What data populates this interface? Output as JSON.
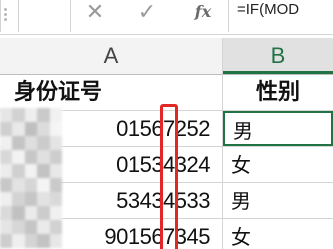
{
  "formula_bar": {
    "cancel_icon": "close-icon",
    "confirm_icon": "check-icon",
    "fx_label": "fx",
    "formula_text": "=IF(MOD"
  },
  "columns": [
    {
      "letter": "A"
    },
    {
      "letter": "B"
    }
  ],
  "table": {
    "headers": {
      "id_number": "身份证号",
      "gender": "性别"
    },
    "rows": [
      {
        "id_visible": "01567252",
        "gender": "男"
      },
      {
        "id_visible": "01534324",
        "gender": "女"
      },
      {
        "id_visible": "53434533",
        "gender": "男"
      },
      {
        "id_visible": "901567345",
        "gender": "女"
      }
    ]
  },
  "colors": {
    "excel_green": "#217346",
    "highlight_red": "#e32626",
    "gridline": "#d4d4d4"
  }
}
